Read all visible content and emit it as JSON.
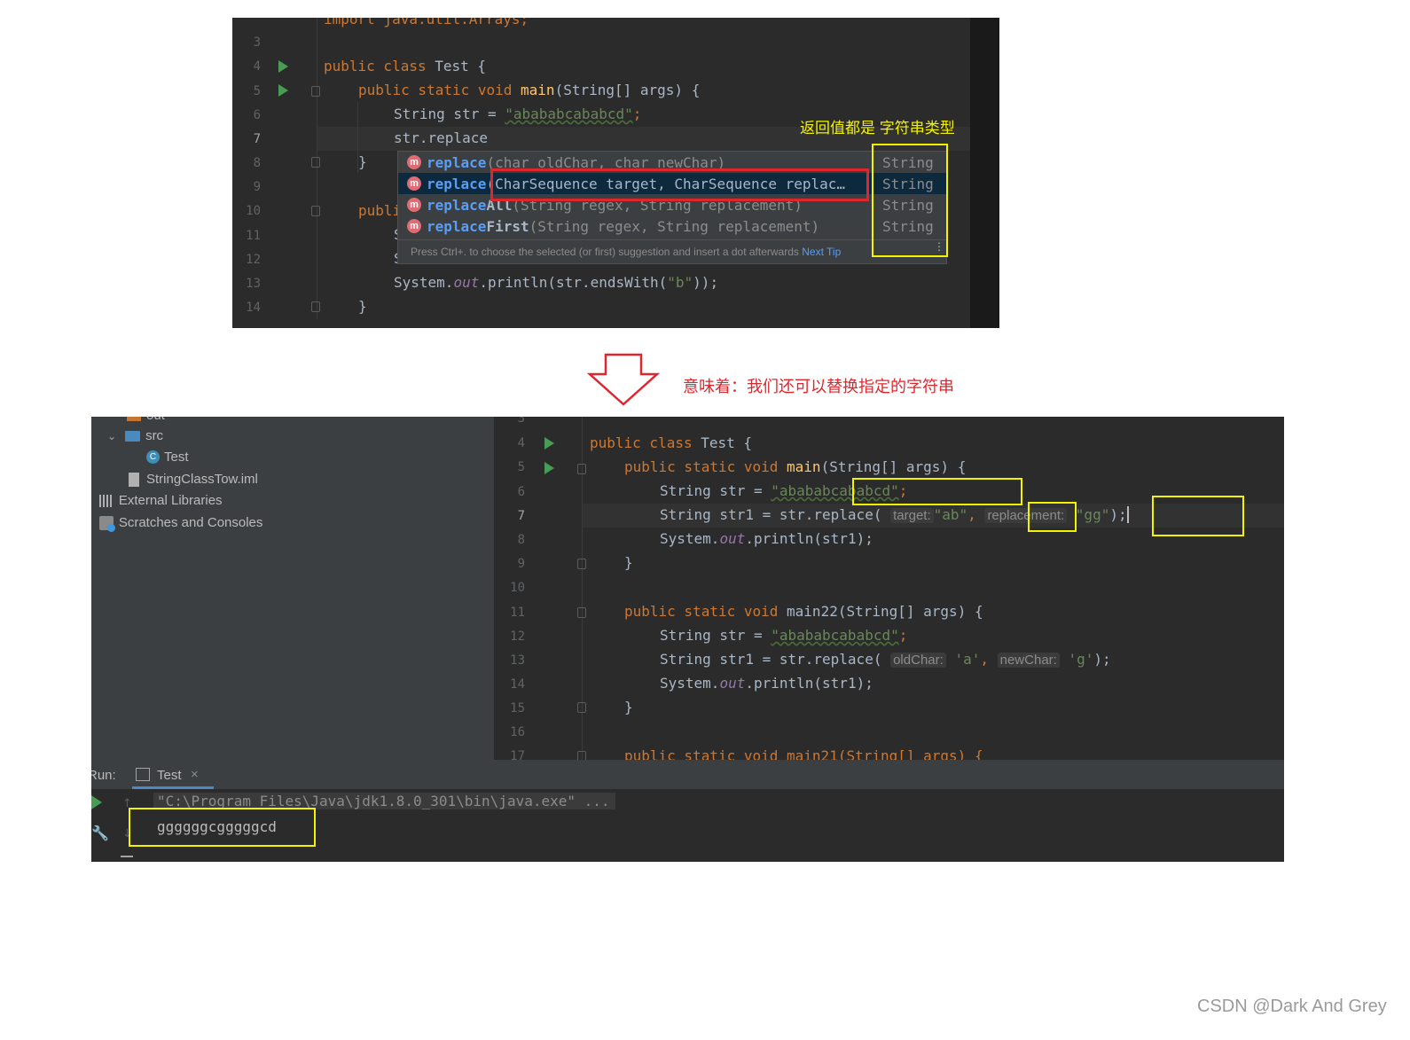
{
  "top_editor": {
    "partial_import": "import java.util.Arrays;",
    "lines": [
      {
        "n": "3",
        "code": ""
      },
      {
        "n": "4",
        "code": "public class Test {"
      },
      {
        "n": "5",
        "code": "public static void main(String[] args) {"
      },
      {
        "n": "6",
        "code_pre": "String str = ",
        "code_str": "\"abababcababcd\"",
        "code_post": ";"
      },
      {
        "n": "7",
        "code": "str.replace"
      },
      {
        "n": "8",
        "code": "}"
      },
      {
        "n": "9",
        "code": ""
      },
      {
        "n": "10",
        "code": "publi"
      },
      {
        "n": "11",
        "code": "S"
      },
      {
        "n": "12",
        "code": "S"
      },
      {
        "n": "13",
        "code_pre": "System.",
        "code_out": "out",
        "code_mid": ".println(str.endsWith(",
        "code_str": "\"b\"",
        "code_post": "));"
      },
      {
        "n": "14",
        "code": "}"
      }
    ],
    "annotation": "返回值都是 字符串类型",
    "completion": {
      "items": [
        {
          "icon": "m",
          "name": "replace",
          "params": "(char oldChar, char newChar)",
          "type": "String"
        },
        {
          "icon": "m",
          "name": "replace",
          "params": "(CharSequence target, CharSequence replac…",
          "type": "String"
        },
        {
          "icon": "m",
          "name_a": "replace",
          "name_b": "All",
          "params": "(String regex, String replacement)",
          "type": "String"
        },
        {
          "icon": "m",
          "name_a": "replace",
          "name_b": "First",
          "params": "(String regex, String replacement)",
          "type": "String"
        }
      ],
      "footer": "Press Ctrl+. to choose the selected (or first) suggestion and insert a dot afterwards",
      "footer_link": "Next Tip"
    }
  },
  "arrow_annotation": "意味着：我们还可以替换指定的字符串",
  "project_tree": {
    "partial_top": "out",
    "items": [
      {
        "label": "src",
        "icon": "folder-icon"
      },
      {
        "label": "Test",
        "icon": "java-class-icon"
      },
      {
        "label": "StringClassTow.iml",
        "icon": "iml-file-icon"
      },
      {
        "label": "External Libraries",
        "icon": "libraries-icon"
      },
      {
        "label": "Scratches and Consoles",
        "icon": "scratches-icon"
      }
    ]
  },
  "bottom_editor": {
    "lines": {
      "l3": "3",
      "l4": "4",
      "l5": "5",
      "l6": "6",
      "l7": "7",
      "l8": "8",
      "l9": "9",
      "l10": "10",
      "l11": "11",
      "l12": "12",
      "l13": "13",
      "l14": "14",
      "l15": "15",
      "l16": "16",
      "l17": "17"
    },
    "kw_public_class": "public class",
    "class_name": " Test {",
    "kw_psv": "public static void",
    "main": "main",
    "main_args": "(String[] args) {",
    "str_decl": "String str = ",
    "str_val": "\"abababcababcd\"",
    "semi": ";",
    "str1_decl": "String str1 = str.replace(",
    "hint_target": "target:",
    "arg_ab": "\"ab\"",
    "comma": ",",
    "hint_replacement": "replacement:",
    "arg_gg": "\"gg\"",
    "close": ");",
    "sys": "System.",
    "out": "out",
    "println": ".println(str1);",
    "brace": "}",
    "main22": "main22",
    "main22_args": "(String[] args) {",
    "hint_oldchar": "oldChar:",
    "arg_a": "'a'",
    "hint_newchar": "newChar:",
    "arg_g": "'g'",
    "main21_partial": "public static void main21(String[] args) {"
  },
  "run_panel": {
    "label": "Run:",
    "tab": "Test",
    "tab_close": "×",
    "command": "\"C:\\Program Files\\Java\\jdk1.8.0_301\\bin\\java.exe\" ...",
    "output": "ggggggcgggggcd"
  },
  "watermark": "CSDN @Dark And Grey",
  "colors": {
    "editor_bg": "#2b2b2b",
    "sidebar_bg": "#3c3f41",
    "keyword": "#cc7832",
    "function": "#ffc66d",
    "string": "#6a8759",
    "highlight_box": "#f3f300",
    "red_box": "#e0262d"
  }
}
